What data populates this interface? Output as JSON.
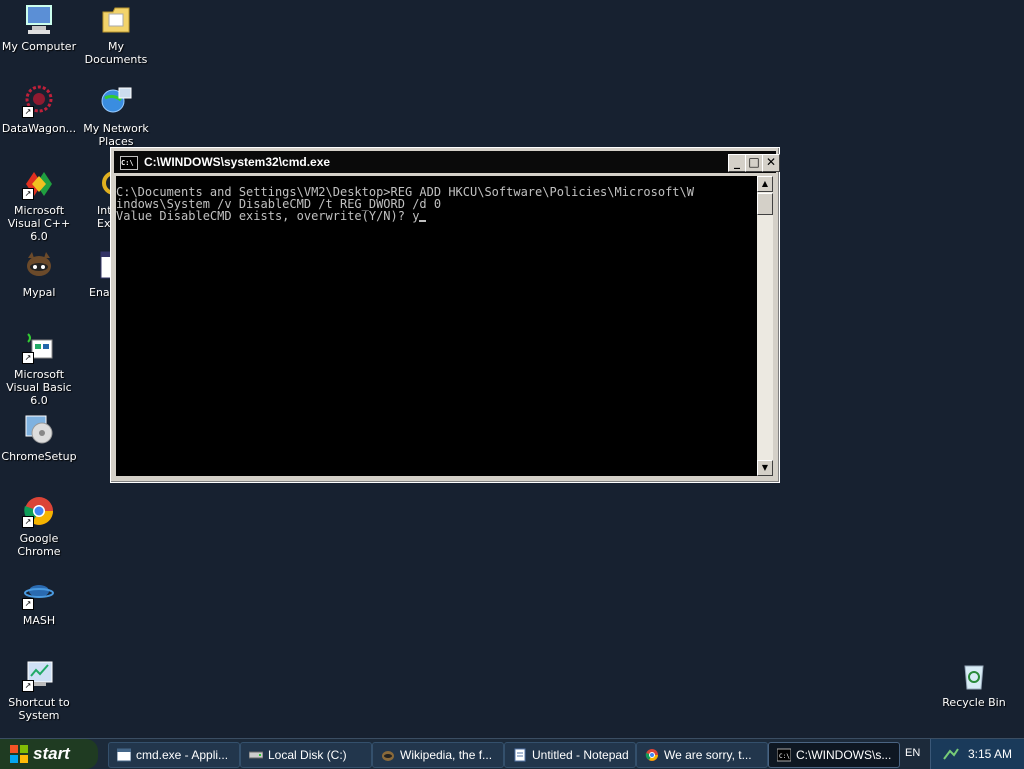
{
  "desktop": {
    "icons": [
      {
        "label": "My Computer"
      },
      {
        "label": "My Documents"
      },
      {
        "label": "DataWagon..."
      },
      {
        "label": "My Network Places"
      },
      {
        "label": "Microsoft Visual C++ 6.0"
      },
      {
        "label": "Int Exp"
      },
      {
        "label": "Mypal"
      },
      {
        "label": "Enab"
      },
      {
        "label": "Microsoft Visual Basic 6.0"
      },
      {
        "label": "ChromeSetup"
      },
      {
        "label": "Google Chrome"
      },
      {
        "label": "MASH"
      },
      {
        "label": "Shortcut to System"
      },
      {
        "label": "Recycle Bin"
      }
    ]
  },
  "window": {
    "title": "C:\\WINDOWS\\system32\\cmd.exe",
    "icon_text": "C:\\",
    "minimize": "_",
    "maximize": "□",
    "close": "✕",
    "console_lines": [
      "C:\\Documents and Settings\\VM2\\Desktop>REG ADD HKCU\\Software\\Policies\\Microsoft\\W",
      "indows\\System /v DisableCMD /t REG_DWORD /d 0",
      "Value DisableCMD exists, overwrite(Y/N)? y"
    ],
    "scroll_up": "▲",
    "scroll_down": "▼"
  },
  "taskbar": {
    "start_label": "start",
    "items": [
      {
        "label": "cmd.exe - Appli..."
      },
      {
        "label": "Local Disk (C:)"
      },
      {
        "label": "Wikipedia, the f..."
      },
      {
        "label": "Untitled - Notepad"
      },
      {
        "label": "We are sorry, t..."
      },
      {
        "label": "C:\\WINDOWS\\s..."
      }
    ],
    "language": "EN",
    "clock": "3:15 AM"
  },
  "colors": {
    "desktop_bg": "#172130",
    "console_bg": "#000000",
    "console_text": "#c0c0c0"
  }
}
